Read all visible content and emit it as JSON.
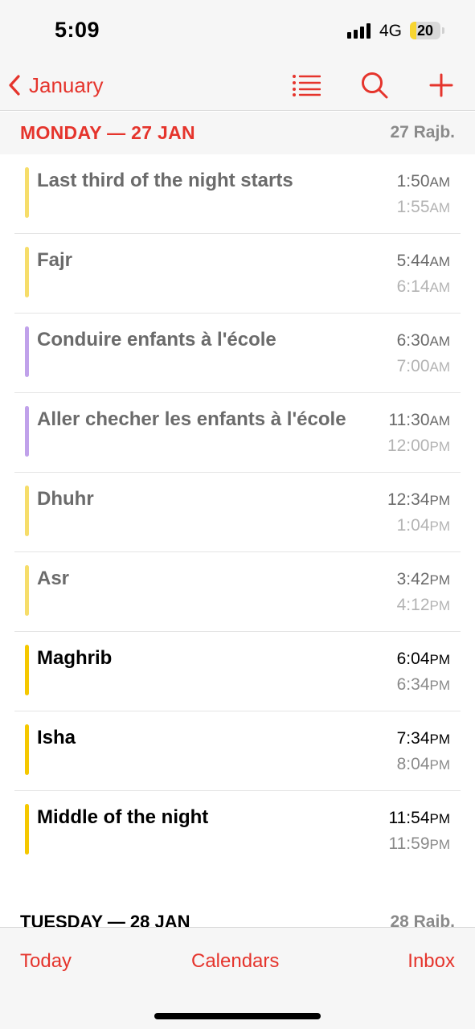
{
  "status_bar": {
    "time": "5:09",
    "network": "4G",
    "battery": "20",
    "battery_level": 0.2,
    "battery_color": "#f7d531"
  },
  "nav": {
    "back_label": "January",
    "back_icon": "chevron-left-icon",
    "list_icon": "list-view-icon",
    "search_icon": "search-icon",
    "add_icon": "plus-icon",
    "accent_color": "#e5342c"
  },
  "day": {
    "title": "MONDAY — 27 JAN",
    "hijri": "27 Rajb."
  },
  "events": [
    {
      "title": "Last third of the night starts",
      "start": "1:50",
      "start_ampm": "AM",
      "end": "1:55",
      "end_ampm": "AM",
      "color": "#f6dd6a",
      "state": "past"
    },
    {
      "title": "Fajr",
      "start": "5:44",
      "start_ampm": "AM",
      "end": "6:14",
      "end_ampm": "AM",
      "color": "#f6dd6a",
      "state": "past"
    },
    {
      "title": "Conduire enfants à l'école",
      "start": "6:30",
      "start_ampm": "AM",
      "end": "7:00",
      "end_ampm": "AM",
      "color": "#c0a1ea",
      "state": "past"
    },
    {
      "title": "Aller checher les enfants à l'école",
      "start": "11:30",
      "start_ampm": "AM",
      "end": "12:00",
      "end_ampm": "PM",
      "color": "#c0a1ea",
      "state": "past"
    },
    {
      "title": "Dhuhr",
      "start": "12:34",
      "start_ampm": "PM",
      "end": "1:04",
      "end_ampm": "PM",
      "color": "#f6dd6a",
      "state": "past"
    },
    {
      "title": "Asr",
      "start": "3:42",
      "start_ampm": "PM",
      "end": "4:12",
      "end_ampm": "PM",
      "color": "#f6dd6a",
      "state": "past"
    },
    {
      "title": "Maghrib",
      "start": "6:04",
      "start_ampm": "PM",
      "end": "6:34",
      "end_ampm": "PM",
      "color": "#f5c800",
      "state": "future"
    },
    {
      "title": "Isha",
      "start": "7:34",
      "start_ampm": "PM",
      "end": "8:04",
      "end_ampm": "PM",
      "color": "#f5c800",
      "state": "future"
    },
    {
      "title": "Middle of the night",
      "start": "11:54",
      "start_ampm": "PM",
      "end": "11:59",
      "end_ampm": "PM",
      "color": "#f5c800",
      "state": "future"
    }
  ],
  "next_day": {
    "title": "TUESDAY — 28 JAN",
    "hijri": "28 Rajb."
  },
  "tabs": {
    "today": "Today",
    "calendars": "Calendars",
    "inbox": "Inbox"
  }
}
